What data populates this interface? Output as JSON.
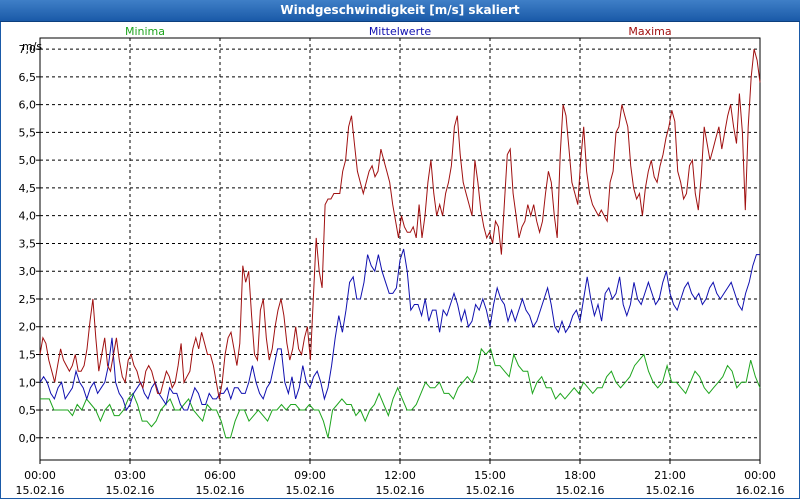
{
  "window": {
    "title": "Windgeschwindigkeit [m/s] skaliert"
  },
  "colors": {
    "minima": "#1ea51e",
    "mittelwerte": "#1010b0",
    "maxima": "#a01010",
    "title_bar": "#1a5aa8"
  },
  "chart_data": {
    "type": "line",
    "ylabel": "m/s",
    "ylim": [
      -0.4,
      7.2
    ],
    "yticks": [
      "0,0",
      "0,5",
      "1,0",
      "1,5",
      "2,0",
      "2,5",
      "3,0",
      "3,5",
      "4,0",
      "4,5",
      "5,0",
      "5,5",
      "6,0",
      "6,5",
      "7,0"
    ],
    "ytick_values": [
      0,
      0.5,
      1,
      1.5,
      2,
      2.5,
      3,
      3.5,
      4,
      4.5,
      5,
      5.5,
      6,
      6.5,
      7
    ],
    "xlim": [
      0,
      24
    ],
    "xticks": [
      {
        "time": "00:00",
        "date": "15.02.16"
      },
      {
        "time": "03:00",
        "date": "15.02.16"
      },
      {
        "time": "06:00",
        "date": "15.02.16"
      },
      {
        "time": "09:00",
        "date": "15.02.16"
      },
      {
        "time": "12:00",
        "date": "15.02.16"
      },
      {
        "time": "15:00",
        "date": "15.02.16"
      },
      {
        "time": "18:00",
        "date": "15.02.16"
      },
      {
        "time": "21:00",
        "date": "15.02.16"
      },
      {
        "time": "00:00",
        "date": "16.02.16"
      }
    ],
    "grid": true,
    "x_hours_step": 0.16667,
    "series": [
      {
        "name": "Minima",
        "color": "#1ea51e",
        "values": [
          0.7,
          0.7,
          0.7,
          0.5,
          0.5,
          0.5,
          0.5,
          0.4,
          0.6,
          0.5,
          0.7,
          0.6,
          0.5,
          0.3,
          0.5,
          0.6,
          0.4,
          0.4,
          0.5,
          0.7,
          0.8,
          0.6,
          0.3,
          0.3,
          0.2,
          0.3,
          0.5,
          0.6,
          0.7,
          0.5,
          0.5,
          0.6,
          0.7,
          0.5,
          0.4,
          0.3,
          0.6,
          0.5,
          0.5,
          0.3,
          0.0,
          0.0,
          0.3,
          0.5,
          0.5,
          0.3,
          0.4,
          0.5,
          0.4,
          0.3,
          0.5,
          0.5,
          0.6,
          0.5,
          0.6,
          0.6,
          0.5,
          0.5,
          0.6,
          0.5,
          0.5,
          0.3,
          0.0,
          0.5,
          0.6,
          0.7,
          0.6,
          0.6,
          0.4,
          0.5,
          0.3,
          0.5,
          0.6,
          0.8,
          0.6,
          0.4,
          0.7,
          0.9,
          0.7,
          0.5,
          0.5,
          0.6,
          0.8,
          1.0,
          0.9,
          0.9,
          1.0,
          0.8,
          0.8,
          0.7,
          0.9,
          1.0,
          1.1,
          1.0,
          1.2,
          1.6,
          1.5,
          1.6,
          1.3,
          1.3,
          1.2,
          1.1,
          1.5,
          1.3,
          1.2,
          1.2,
          0.8,
          1.0,
          1.1,
          0.9,
          0.9,
          0.7,
          0.8,
          0.7,
          0.8,
          0.9,
          0.8,
          1.0,
          0.9,
          0.8,
          0.9,
          0.9,
          1.1,
          1.2,
          1.0,
          0.9,
          1.0,
          1.1,
          1.3,
          1.4,
          1.5,
          1.2,
          1.0,
          0.9,
          1.0,
          1.3,
          1.0,
          1.0,
          0.9,
          0.8,
          1.0,
          1.2,
          1.1,
          0.9,
          0.8,
          0.9,
          1.0,
          1.1,
          1.3,
          1.2,
          0.9,
          1.0,
          1.0,
          1.4,
          1.1,
          0.9
        ]
      },
      {
        "name": "Mittelwerte",
        "color": "#1010b0",
        "values": [
          1.0,
          1.1,
          1.0,
          0.8,
          0.7,
          0.9,
          1.0,
          0.7,
          0.8,
          0.9,
          1.2,
          1.0,
          0.9,
          0.7,
          0.9,
          1.0,
          0.8,
          0.9,
          1.0,
          1.3,
          1.8,
          1.0,
          0.8,
          0.7,
          0.5,
          0.6,
          0.8,
          0.9,
          1.0,
          0.8,
          0.7,
          0.9,
          1.0,
          0.8,
          0.7,
          0.6,
          0.9,
          0.8,
          0.8,
          0.6,
          0.5,
          0.5,
          0.7,
          0.9,
          0.8,
          0.6,
          0.6,
          0.8,
          0.7,
          0.7,
          0.8,
          0.8,
          0.9,
          0.7,
          0.9,
          0.9,
          0.8,
          0.8,
          1.0,
          1.3,
          1.0,
          0.8,
          0.7,
          0.9,
          1.0,
          1.3,
          1.6,
          1.6,
          1.0,
          0.8,
          1.1,
          0.7,
          0.9,
          1.3,
          1.0,
          0.9,
          1.1,
          1.2,
          1.0,
          0.7,
          0.9,
          1.3,
          1.8,
          2.2,
          1.9,
          2.3,
          2.8,
          2.9,
          2.5,
          2.5,
          2.8,
          3.3,
          3.1,
          3.0,
          3.3,
          3.0,
          2.8,
          2.6,
          2.6,
          2.7,
          3.2,
          3.4,
          3.0,
          2.3,
          2.4,
          2.4,
          2.2,
          2.5,
          2.1,
          2.3,
          2.3,
          1.9,
          2.3,
          2.2,
          2.4,
          2.6,
          2.4,
          2.1,
          2.3,
          2.0,
          2.1,
          2.4,
          2.3,
          2.5,
          2.3,
          2.0,
          2.4,
          2.7,
          2.5,
          2.4,
          2.1,
          2.3,
          2.1,
          2.3,
          2.5,
          2.3,
          2.2,
          2.0,
          2.1,
          2.3,
          2.5,
          2.7,
          2.4,
          2.0,
          1.9,
          2.1,
          1.9,
          2.0,
          2.2,
          2.3,
          2.1,
          2.5,
          2.9,
          2.5,
          2.2,
          2.4,
          2.1,
          2.6,
          2.7,
          2.5,
          2.6,
          2.9,
          2.4,
          2.2,
          2.4,
          2.8,
          2.5,
          2.4,
          2.6,
          2.8,
          2.6,
          2.4,
          2.5,
          2.8,
          3.0,
          2.6,
          2.4,
          2.3,
          2.5,
          2.7,
          2.8,
          2.6,
          2.5,
          2.6,
          2.4,
          2.5,
          2.7,
          2.8,
          2.6,
          2.5,
          2.6,
          2.7,
          2.8,
          2.6,
          2.4,
          2.3,
          2.6,
          2.8,
          3.1,
          3.3,
          3.3
        ]
      },
      {
        "name": "Maxima",
        "color": "#a01010",
        "values": [
          1.5,
          1.8,
          1.7,
          1.4,
          1.2,
          1.0,
          1.3,
          1.6,
          1.4,
          1.3,
          1.2,
          1.3,
          1.5,
          1.2,
          1.2,
          1.3,
          1.6,
          2.1,
          2.5,
          1.8,
          1.2,
          1.5,
          1.8,
          1.3,
          1.2,
          1.5,
          1.8,
          1.4,
          1.1,
          1.0,
          1.4,
          1.5,
          1.3,
          1.2,
          1.0,
          0.9,
          1.2,
          1.3,
          1.2,
          1.0,
          0.8,
          0.8,
          1.0,
          1.2,
          1.1,
          0.9,
          1.0,
          1.3,
          1.7,
          1.0,
          1.1,
          1.2,
          1.6,
          1.8,
          1.6,
          1.9,
          1.7,
          1.5,
          1.5,
          1.3,
          1.0,
          0.7,
          1.0,
          1.5,
          1.8,
          1.9,
          1.6,
          1.3,
          1.7,
          3.1,
          2.8,
          3.0,
          2.2,
          1.5,
          1.4,
          2.3,
          2.5,
          1.8,
          1.4,
          1.6,
          2.0,
          2.3,
          2.5,
          2.2,
          1.7,
          1.4,
          1.6,
          2.0,
          1.6,
          1.5,
          1.8,
          2.0,
          1.4,
          2.5,
          3.6,
          3.0,
          2.7,
          4.2,
          4.3,
          4.3,
          4.4,
          4.4,
          4.4,
          4.8,
          5.0,
          5.6,
          5.8,
          5.3,
          4.8,
          4.6,
          4.4,
          4.6,
          4.8,
          4.9,
          4.7,
          4.8,
          5.2,
          5.0,
          4.8,
          4.6,
          4.2,
          3.9,
          3.6,
          4.0,
          3.8,
          3.7,
          3.7,
          3.8,
          3.6,
          4.2,
          3.6,
          4.0,
          4.6,
          5.0,
          4.4,
          4.0,
          4.2,
          4.0,
          4.4,
          4.6,
          4.9,
          5.6,
          5.8,
          5.1,
          4.6,
          4.4,
          4.2,
          4.0,
          5.0,
          4.6,
          4.1,
          3.8,
          3.6,
          3.7,
          3.5,
          3.9,
          3.8,
          3.3,
          4.2,
          5.1,
          5.2,
          4.4,
          4.0,
          3.6,
          3.8,
          3.9,
          4.2,
          4.0,
          4.2,
          3.9,
          3.7,
          3.9,
          4.4,
          4.8,
          4.6,
          4.0,
          3.6,
          5.1,
          6.0,
          5.8,
          5.2,
          4.6,
          4.4,
          4.2,
          5.0,
          5.6,
          4.8,
          4.4,
          4.2,
          4.1,
          4.0,
          4.1,
          4.0,
          3.9,
          4.6,
          4.8,
          5.5,
          5.6,
          6.0,
          5.8,
          5.6,
          4.9,
          4.5,
          4.3,
          4.4,
          4.0,
          4.5,
          4.8,
          5.0,
          4.7,
          4.6,
          4.9,
          5.1,
          5.4,
          5.6,
          5.9,
          5.7,
          4.8,
          4.6,
          4.3,
          4.4,
          4.9,
          5.0,
          4.4,
          4.1,
          4.7,
          5.6,
          5.3,
          5.0,
          5.2,
          5.4,
          5.6,
          5.2,
          5.5,
          5.8,
          6.0,
          5.6,
          5.3,
          6.2,
          5.5,
          4.1,
          5.6,
          6.5,
          7.0,
          6.8,
          6.4
        ]
      }
    ]
  }
}
